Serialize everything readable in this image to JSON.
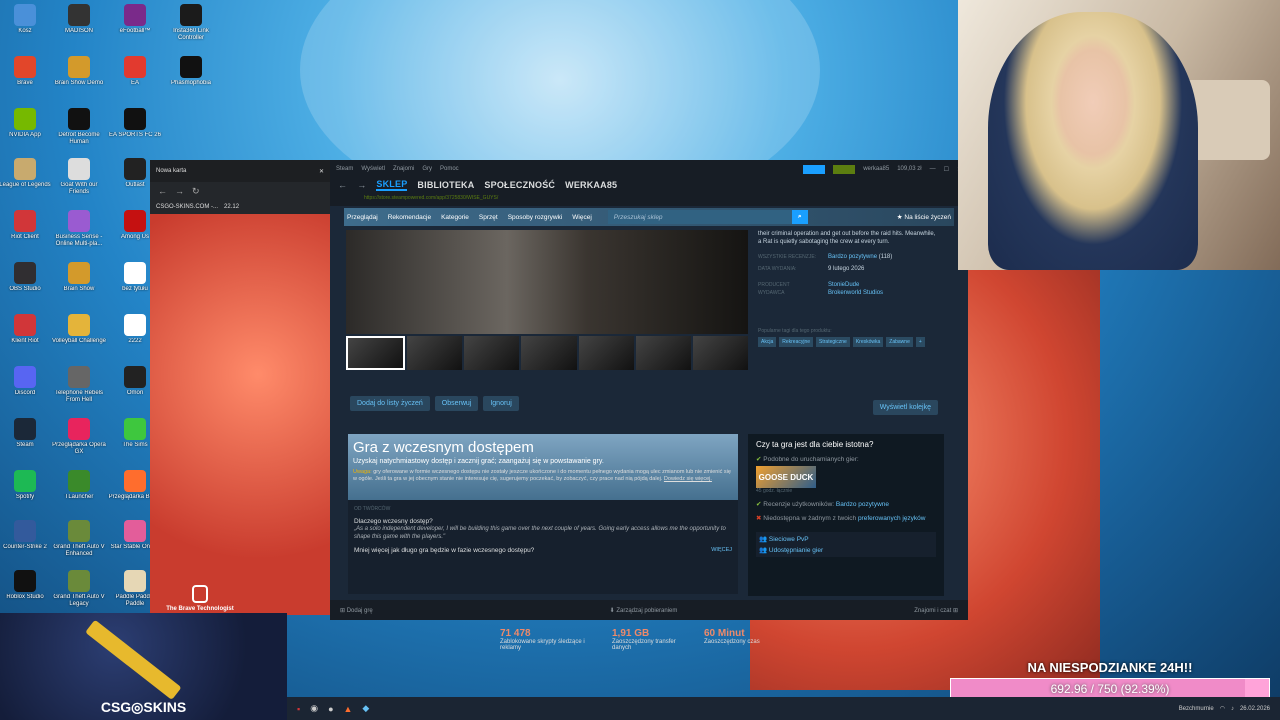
{
  "desktop": {
    "icons": [
      {
        "label": "Kosz",
        "color": "#4a90d9"
      },
      {
        "label": "MADISON",
        "color": "#333"
      },
      {
        "label": "eFootball™",
        "color": "#7a2a8a"
      },
      {
        "label": "Insta360 Link Controller",
        "color": "#1b1b1b"
      },
      {
        "label": "Brave",
        "color": "#e2462a"
      },
      {
        "label": "Brain Show Demo",
        "color": "#d39a2b"
      },
      {
        "label": "EA",
        "color": "#e23a2f"
      },
      {
        "label": "Phasmophobia",
        "color": "#111"
      },
      {
        "label": "NVIDIA App",
        "color": "#76b900"
      },
      {
        "label": "Detroit Become Human",
        "color": "#111"
      },
      {
        "label": "EA SPORTS FC 26",
        "color": "#111"
      },
      {
        "label": "League of Legends",
        "color": "#c8aa6e"
      },
      {
        "label": "Goat With our Friends",
        "color": "#ddd"
      },
      {
        "label": "Outlast",
        "color": "#222"
      },
      {
        "label": "Riot Client",
        "color": "#d13639"
      },
      {
        "label": "Business Sense - Online Multi-pla...",
        "color": "#9a5bd1"
      },
      {
        "label": "Among Us",
        "color": "#c51111"
      },
      {
        "label": "OBS Studio",
        "color": "#302e31"
      },
      {
        "label": "Brain Show",
        "color": "#d39a2b"
      },
      {
        "label": "bez tytułu",
        "color": "#fff"
      },
      {
        "label": "Klient Riot",
        "color": "#d13639"
      },
      {
        "label": "Volleyball Challenge",
        "color": "#e4b43a"
      },
      {
        "label": "2222",
        "color": "#fff"
      },
      {
        "label": "Discord",
        "color": "#5865f2"
      },
      {
        "label": "Telephone Rebels From Hell",
        "color": "#666"
      },
      {
        "label": "Omori",
        "color": "#222"
      },
      {
        "label": "Steam",
        "color": "#1b2838"
      },
      {
        "label": "Przeglądarka Opera GX",
        "color": "#e8245d"
      },
      {
        "label": "The Sims",
        "color": "#3ec73e"
      },
      {
        "label": "Spotify",
        "color": "#1db954"
      },
      {
        "label": "TLauncher",
        "color": "#3a8a2a"
      },
      {
        "label": "Przeglądarka Brave",
        "color": "#ff6d2d"
      },
      {
        "label": "Counter-Strike 2",
        "color": "#335a9c"
      },
      {
        "label": "Grand Theft Auto V Enhanced",
        "color": "#6a8a3a"
      },
      {
        "label": "Star Stable Online",
        "color": "#e35d9a"
      },
      {
        "label": "Roblox Studio",
        "color": "#111"
      },
      {
        "label": "Grand Theft Auto V Legacy",
        "color": "#6a8a3a"
      },
      {
        "label": "Paddle Paddle Paddle",
        "color": "#e6d7b5"
      }
    ]
  },
  "browser": {
    "tab_title": "Nowa karta",
    "bookmarks": [
      "CSGO-SKINS.COM -...",
      "22.12"
    ]
  },
  "steam": {
    "top_menu": [
      "Steam",
      "Wyświetl",
      "Znajomi",
      "Gry",
      "Pomoc"
    ],
    "user": "werkaa85",
    "balance": "109,03 zł",
    "main_tabs": [
      "SKLEP",
      "BIBLIOTEKA",
      "SPOŁECZNOŚĆ",
      "WERKAA85"
    ],
    "url": "https://store.steampowered.com/app/3725830/WISE_GUYS/",
    "store_nav": [
      "Przeglądaj",
      "Rekomendacje",
      "Kategorie",
      "Sprzęt",
      "Sposoby rozgrywki",
      "Więcej"
    ],
    "search_placeholder": "Przeszukaj sklep",
    "wishlist_link": "Na liście życzeń",
    "description": "their criminal operation and get out before the raid hits. Meanwhile, a Rat is quietly sabotaging the crew at every turn.",
    "reviews_label": "WSZYSTKIE RECENZJE:",
    "reviews_value": "Bardzo pozytywne",
    "reviews_count": "(118)",
    "release_label": "DATA WYDANIA:",
    "release_value": "9 lutego 2026",
    "dev_label": "PRODUCENT",
    "dev_value": "StonieDude",
    "pub_label": "WYDAWCA",
    "pub_value": "Brokenworld Studios",
    "tags_label": "Popularne tagi dla tego produktu:",
    "tags": [
      "Akcja",
      "Rekreacyjne",
      "Strategiczne",
      "Kreskówka",
      "Zabawne",
      "+"
    ],
    "buttons": {
      "wishlist": "Dodaj do listy życzeń",
      "follow": "Obserwuj",
      "ignore": "Ignoruj",
      "queue": "Wyświetl kolejkę"
    },
    "early": {
      "title": "Gra z wczesnym dostępem",
      "subtitle": "Uzyskaj natychmiastowy dostęp i zacznij grać; zaangażuj się w powstawanie gry.",
      "warn_label": "Uwaga:",
      "warn": "gry oferowane w formie wczesnego dostępu nie zostały jeszcze ukończone i do momentu pełnego wydania mogą ulec zmianom lub nie zmienić się w ogóle. Jeśli ta gra w jej obecnym stanie nie interesuje cię, sugerujemy poczekać, by zobaczyć, czy prace nad nią pójdą dalej.",
      "warn_link": "Dowiedz się więcej.",
      "section": "OD TWÓRCÓW",
      "q1": "Dlaczego wczesny dostęp?",
      "a1": "„As a solo independent developer, I will be building this game over the next couple of years. Going early access allows me the opportunity to shape this game with the players.\"",
      "q2": "Mniej więcej jak długo gra będzie w fazie wczesnego dostępu?",
      "more": "WIĘCEJ"
    },
    "relevant": {
      "title": "Czy ta gra jest dla ciebie istotna?",
      "similar": "Podobne do uruchamianych gier:",
      "game": "GOOSE DUCK",
      "hours": "45 godz. łącznie",
      "user_reviews_label": "Recenzje użytkowników:",
      "user_reviews_value": "Bardzo pozytywne",
      "lang_label": "Niedostępna w żadnym z twoich",
      "lang_value": "preferowanych języków",
      "f1": "Sieciowe PvP",
      "f2": "Udostępnianie gier"
    },
    "bottom": {
      "add": "Dodaj grę",
      "downloads": "Zarządzaj pobieraniem",
      "friends": "Znajomi i czat"
    }
  },
  "brave_stats": [
    {
      "value": "71 478",
      "label": "Zablokowane skrypty śledzące i reklamy"
    },
    {
      "value": "1,91 GB",
      "label": "Zaoszczędzony transfer danych"
    },
    {
      "value": "60 Minut",
      "label": "Zaoszczędzony czas"
    }
  ],
  "logo_text": "The Brave Technologist",
  "csgo_brand": "CSG◎SKINS",
  "goal": {
    "title": "NA NIESPODZIANKE 24H!!",
    "text": "692.96 / 750 (92.39%)",
    "fraction": 0.9239
  },
  "tray": {
    "status": "Bezchmurnie",
    "date": "26.02.2026"
  }
}
